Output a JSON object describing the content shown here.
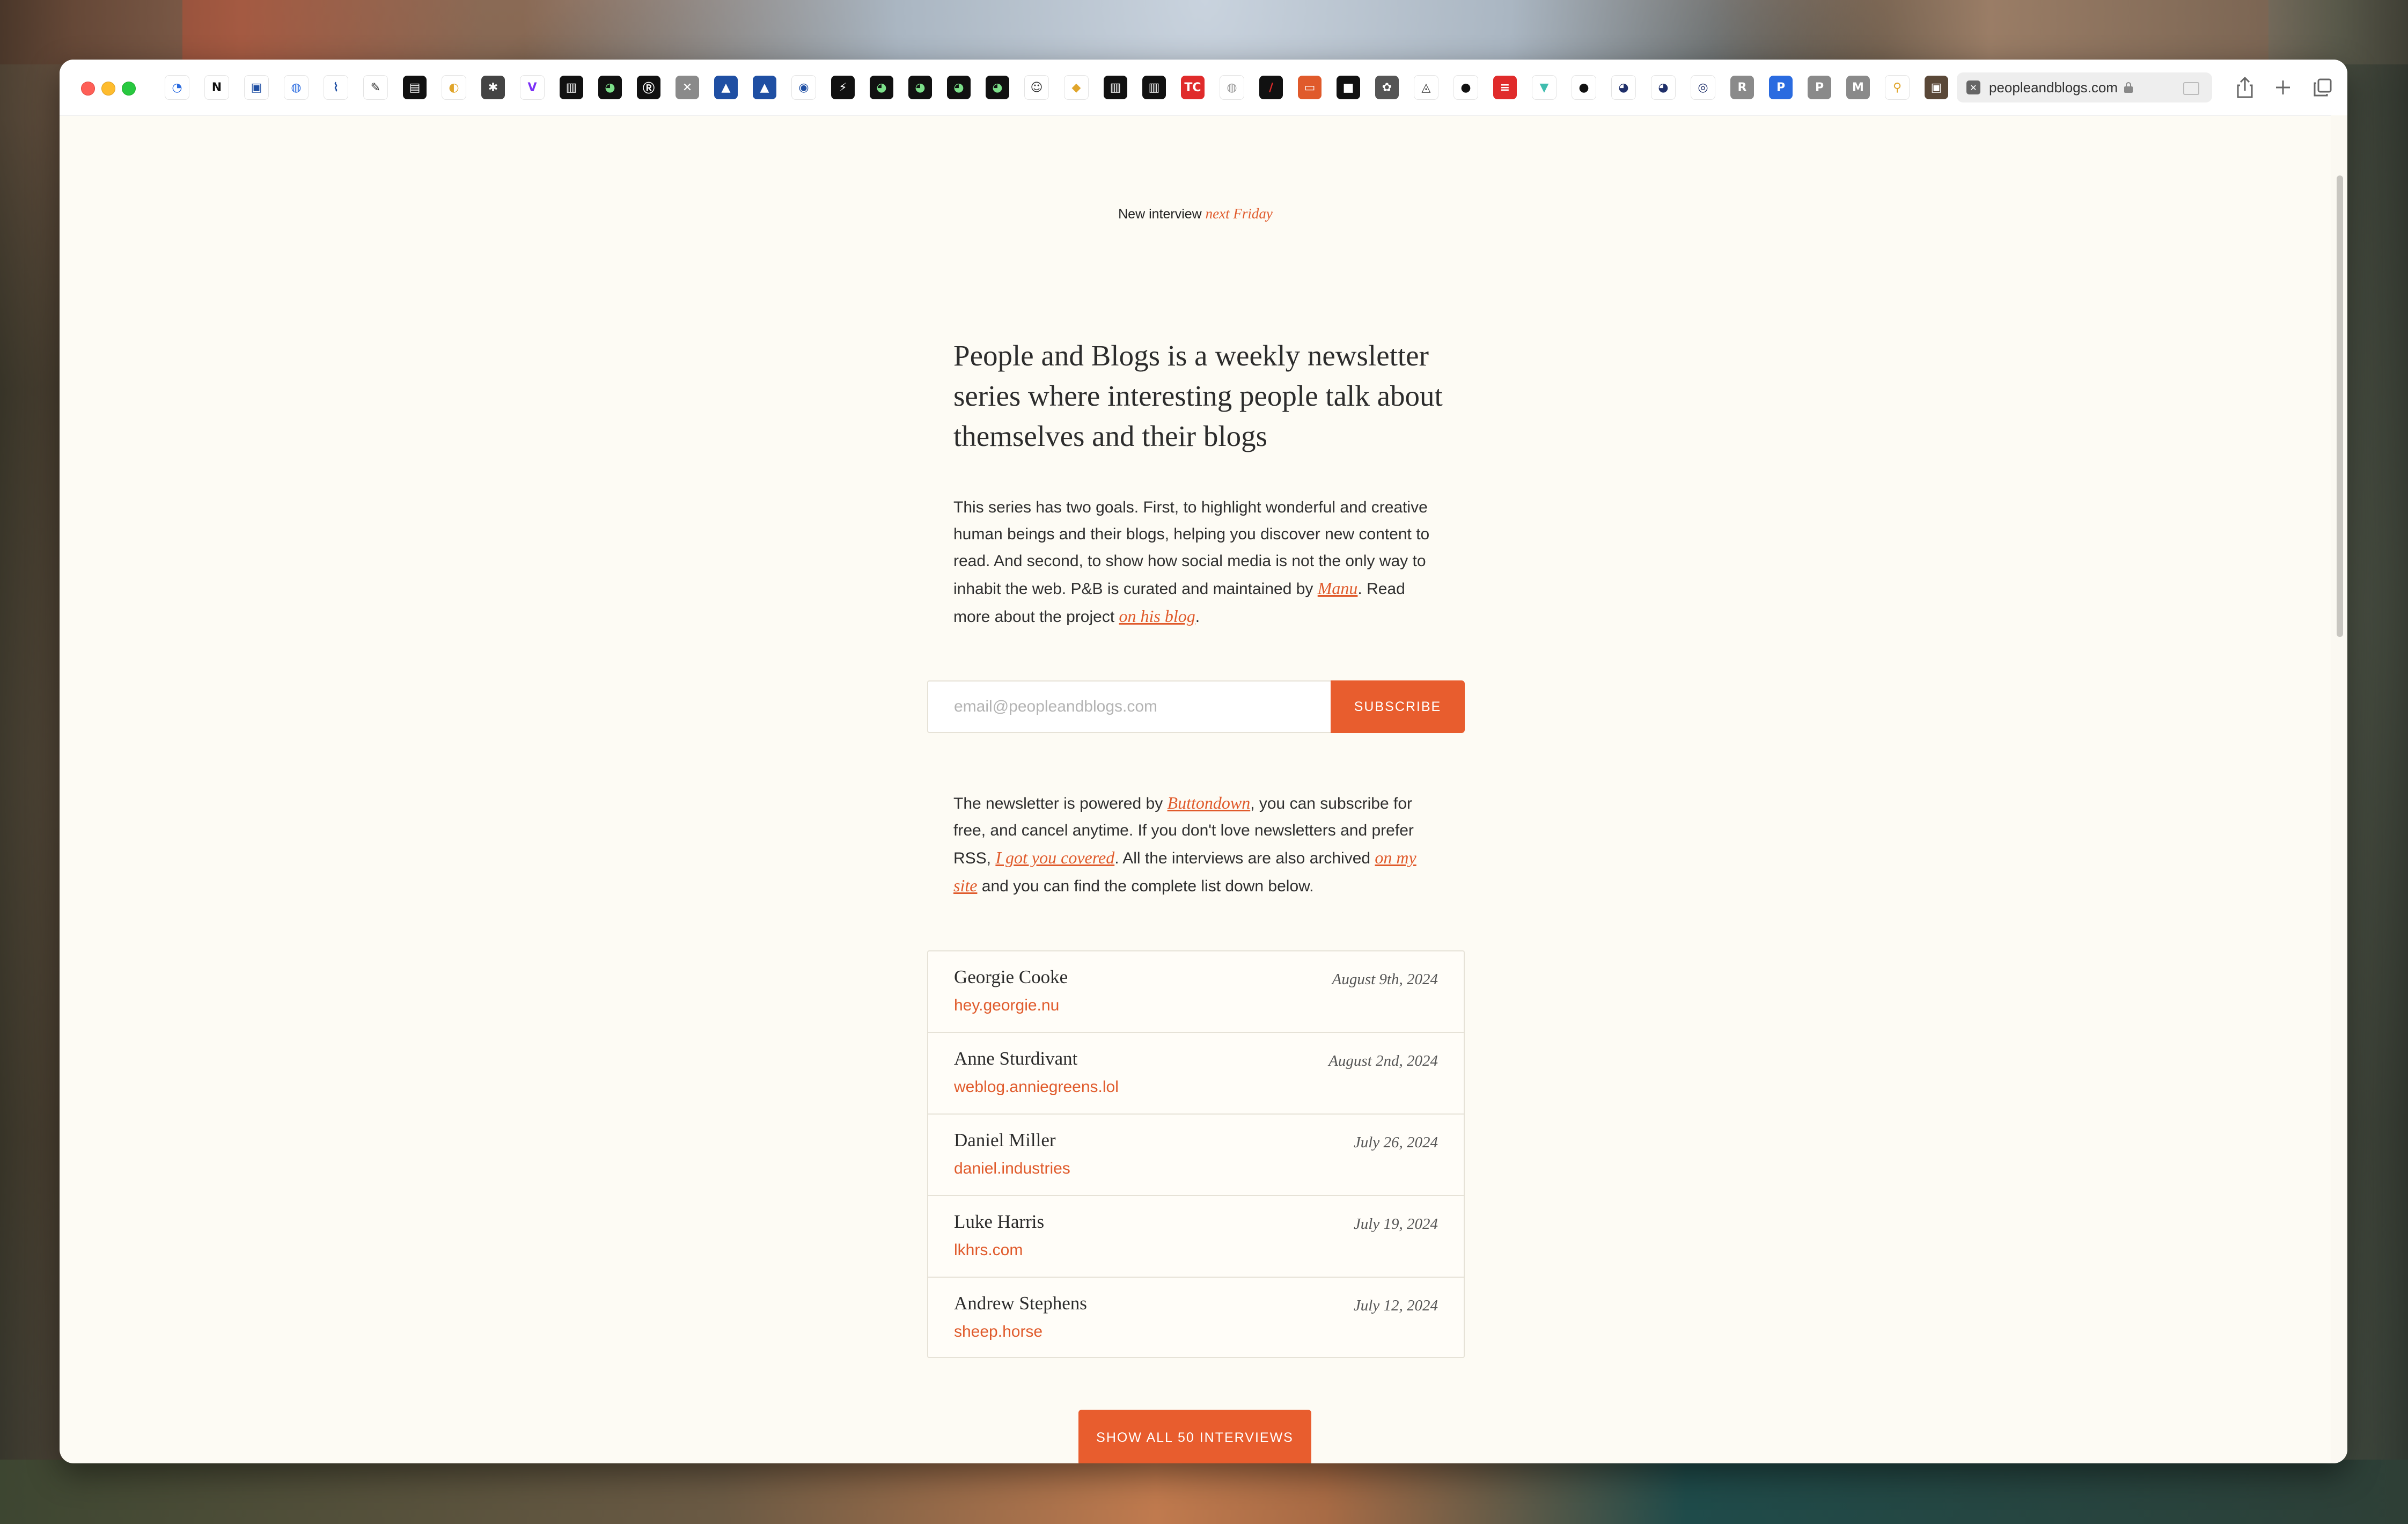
{
  "browser": {
    "url": "peopleandblogs.com",
    "favorites": [
      {
        "name": "fav-1",
        "glyph": "◔",
        "bg": "#ffffff",
        "fg": "#2a6be0"
      },
      {
        "name": "fav-notion",
        "glyph": "N",
        "bg": "#ffffff",
        "fg": "#111111"
      },
      {
        "name": "fav-3",
        "glyph": "▣",
        "bg": "#ffffff",
        "fg": "#1f4fa3"
      },
      {
        "name": "fav-4",
        "glyph": "◍",
        "bg": "#ffffff",
        "fg": "#2a6be0"
      },
      {
        "name": "fav-rss",
        "glyph": "⌇",
        "bg": "#ffffff",
        "fg": "#1f4fa3"
      },
      {
        "name": "fav-6",
        "glyph": "✎",
        "bg": "#ffffff",
        "fg": "#333333"
      },
      {
        "name": "fav-7",
        "glyph": "▤",
        "bg": "#111111",
        "fg": "#ffffff"
      },
      {
        "name": "fav-8",
        "glyph": "◐",
        "bg": "#ffffff",
        "fg": "#e0a52b"
      },
      {
        "name": "fav-9",
        "glyph": "✱",
        "bg": "#444444",
        "fg": "#ffffff"
      },
      {
        "name": "fav-10",
        "glyph": "V",
        "bg": "#ffffff",
        "fg": "#7b2ff7"
      },
      {
        "name": "fav-11",
        "glyph": "▥",
        "bg": "#111111",
        "fg": "#ffffff"
      },
      {
        "name": "fav-12",
        "glyph": "◕",
        "bg": "#111111",
        "fg": "#7ce08a"
      },
      {
        "name": "fav-13",
        "glyph": "Ⓡ",
        "bg": "#111111",
        "fg": "#ffffff"
      },
      {
        "name": "fav-14",
        "glyph": "✕",
        "bg": "#8a8a8a",
        "fg": "#ffffff"
      },
      {
        "name": "fav-15",
        "glyph": "▲",
        "bg": "#1f4fa3",
        "fg": "#ffffff"
      },
      {
        "name": "fav-16",
        "glyph": "▲",
        "bg": "#1f4fa3",
        "fg": "#ffffff"
      },
      {
        "name": "fav-17",
        "glyph": "◉",
        "bg": "#ffffff",
        "fg": "#1f4fa3"
      },
      {
        "name": "fav-18",
        "glyph": "⚡",
        "bg": "#111111",
        "fg": "#ffffff"
      },
      {
        "name": "fav-19",
        "glyph": "◕",
        "bg": "#111111",
        "fg": "#7ce08a"
      },
      {
        "name": "fav-20",
        "glyph": "◕",
        "bg": "#111111",
        "fg": "#7ce08a"
      },
      {
        "name": "fav-21",
        "glyph": "◕",
        "bg": "#111111",
        "fg": "#7ce08a"
      },
      {
        "name": "fav-22",
        "glyph": "◕",
        "bg": "#111111",
        "fg": "#7ce08a"
      },
      {
        "name": "fav-23",
        "glyph": "☺",
        "bg": "#ffffff",
        "fg": "#333333"
      },
      {
        "name": "fav-24",
        "glyph": "◆",
        "bg": "#ffffff",
        "fg": "#e0a52b"
      },
      {
        "name": "fav-25",
        "glyph": "▥",
        "bg": "#111111",
        "fg": "#ffffff"
      },
      {
        "name": "fav-26",
        "glyph": "▥",
        "bg": "#111111",
        "fg": "#ffffff"
      },
      {
        "name": "fav-techcrunch",
        "glyph": "TC",
        "bg": "#e02b2b",
        "fg": "#ffffff"
      },
      {
        "name": "fav-28",
        "glyph": "◍",
        "bg": "#ffffff",
        "fg": "#999999"
      },
      {
        "name": "fav-29",
        "glyph": "∕",
        "bg": "#111111",
        "fg": "#e02b2b"
      },
      {
        "name": "fav-30",
        "glyph": "▭",
        "bg": "#e05a2b",
        "fg": "#ffffff"
      },
      {
        "name": "fav-31",
        "glyph": "■",
        "bg": "#111111",
        "fg": "#ffffff"
      },
      {
        "name": "fav-32",
        "glyph": "✿",
        "bg": "#555555",
        "fg": "#ffffff"
      },
      {
        "name": "fav-33",
        "glyph": "◬",
        "bg": "#ffffff",
        "fg": "#333333"
      },
      {
        "name": "fav-github",
        "glyph": "●",
        "bg": "#ffffff",
        "fg": "#111111"
      },
      {
        "name": "fav-35",
        "glyph": "≡",
        "bg": "#e02b2b",
        "fg": "#ffffff"
      },
      {
        "name": "fav-36",
        "glyph": "▼",
        "bg": "#ffffff",
        "fg": "#3fbcae"
      },
      {
        "name": "fav-github-2",
        "glyph": "●",
        "bg": "#ffffff",
        "fg": "#111111"
      },
      {
        "name": "fav-38",
        "glyph": "◕",
        "bg": "#ffffff",
        "fg": "#1f2f6a"
      },
      {
        "name": "fav-39",
        "glyph": "◕",
        "bg": "#ffffff",
        "fg": "#1f2f6a"
      },
      {
        "name": "fav-40",
        "glyph": "◎",
        "bg": "#ffffff",
        "fg": "#1f2f6a"
      },
      {
        "name": "fav-41",
        "glyph": "R",
        "bg": "#8a8a8a",
        "fg": "#ffffff"
      },
      {
        "name": "fav-42",
        "glyph": "P",
        "bg": "#2a6be0",
        "fg": "#ffffff"
      },
      {
        "name": "fav-43",
        "glyph": "P",
        "bg": "#8a8a8a",
        "fg": "#ffffff"
      },
      {
        "name": "fav-44",
        "glyph": "M",
        "bg": "#8a8a8a",
        "fg": "#ffffff"
      },
      {
        "name": "fav-45",
        "glyph": "⚲",
        "bg": "#ffffff",
        "fg": "#e0a52b"
      },
      {
        "name": "fav-46",
        "glyph": "▣",
        "bg": "#5a4838",
        "fg": "#ffffff"
      }
    ]
  },
  "page": {
    "announcement_prefix": "New interview",
    "announcement_link": "next Friday",
    "intro_title": "People and Blogs is a weekly newsletter series where interesting people talk about themselves and their blogs",
    "description": {
      "text1": "This series has two goals. First, to highlight wonderful and creative human beings and their blogs, helping you discover new content to read. And second, to show how social media is not the only way to inhabit the web. P&B is curated and maintained by ",
      "link_manu": "Manu",
      "text2": ". Read more about the project ",
      "link_blog": "on his blog",
      "text3": "."
    },
    "signup": {
      "placeholder": "email@peopleandblogs.com",
      "button": "SUBSCRIBE"
    },
    "newsletter_info": {
      "text1": "The newsletter is powered by ",
      "link_buttondown": "Buttondown",
      "text2": ", you can subscribe for free, and cancel anytime. If you don't love newsletters and prefer RSS, ",
      "link_rss": "I got you covered",
      "text3": ". All the interviews are also archived ",
      "link_site": "on my site",
      "text4": " and you can find the complete list down below."
    },
    "interviews": [
      {
        "name": "Georgie Cooke",
        "site": "hey.georgie.nu",
        "date": "August 9th, 2024"
      },
      {
        "name": "Anne Sturdivant",
        "site": "weblog.anniegreens.lol",
        "date": "August 2nd, 2024"
      },
      {
        "name": "Daniel Miller",
        "site": "daniel.industries",
        "date": "July 26, 2024"
      },
      {
        "name": "Luke Harris",
        "site": "lkhrs.com",
        "date": "July 19, 2024"
      },
      {
        "name": "Andrew Stephens",
        "site": "sheep.horse",
        "date": "July 12, 2024"
      }
    ],
    "show_all_button": "SHOW ALL 50 INTERVIEWS"
  },
  "colors": {
    "accent": "#e85d2e",
    "link": "#e05a2b",
    "page_bg": "#fdfbf4"
  }
}
